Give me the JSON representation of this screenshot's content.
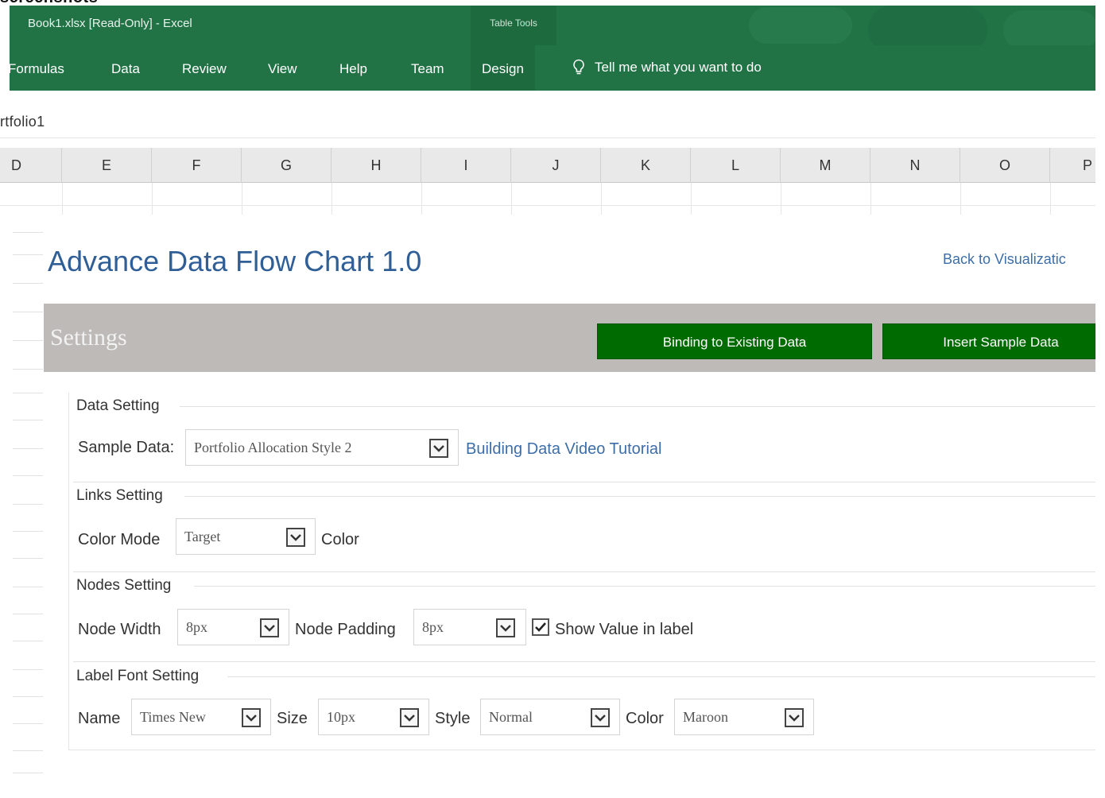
{
  "window": {
    "top_caption": "screenshots",
    "title": "Book1.xlsx  [Read-Only]  -  Excel",
    "table_tools_label": "Table Tools"
  },
  "ribbon": {
    "tabs": [
      "Formulas",
      "Data",
      "Review",
      "View",
      "Help",
      "Team"
    ],
    "active_tab": "Design",
    "tell_me": "Tell me what you want to do"
  },
  "namebox": {
    "text": "rtfolio1"
  },
  "columns": [
    "D",
    "E",
    "F",
    "G",
    "H",
    "I",
    "J",
    "K",
    "L",
    "M",
    "N",
    "O",
    "P"
  ],
  "addin": {
    "title": "Advance Data Flow Chart 1.0",
    "back_link": "Back to Visualizatic",
    "settings_title": "Settings",
    "binding_button": "Binding to Existing Data",
    "insert_button": "Insert Sample Data"
  },
  "data_setting": {
    "title": "Data Setting",
    "sample_label": "Sample Data:",
    "sample_value": "Portfolio Allocation Style 2",
    "video_link": "Building Data Video Tutorial"
  },
  "links_setting": {
    "title": "Links Setting",
    "color_mode_label": "Color Mode",
    "color_mode_value": "Target",
    "color_label": "Color"
  },
  "nodes_setting": {
    "title": "Nodes Setting",
    "width_label": "Node Width",
    "width_value": "8px",
    "padding_label": "Node Padding",
    "padding_value": "8px",
    "show_value_label": "Show Value in label",
    "show_value_checked": true
  },
  "label_font_setting": {
    "title": "Label Font Setting",
    "name_label": "Name",
    "name_value": "Times New",
    "size_label": "Size",
    "size_value": "10px",
    "style_label": "Style",
    "style_value": "Normal",
    "color_label": "Color",
    "color_value": "Maroon"
  },
  "colors": {
    "excel_green": "#217346",
    "button_green": "#006b00",
    "settings_bar": "#bdbab7",
    "title_blue": "#2f5f96"
  }
}
